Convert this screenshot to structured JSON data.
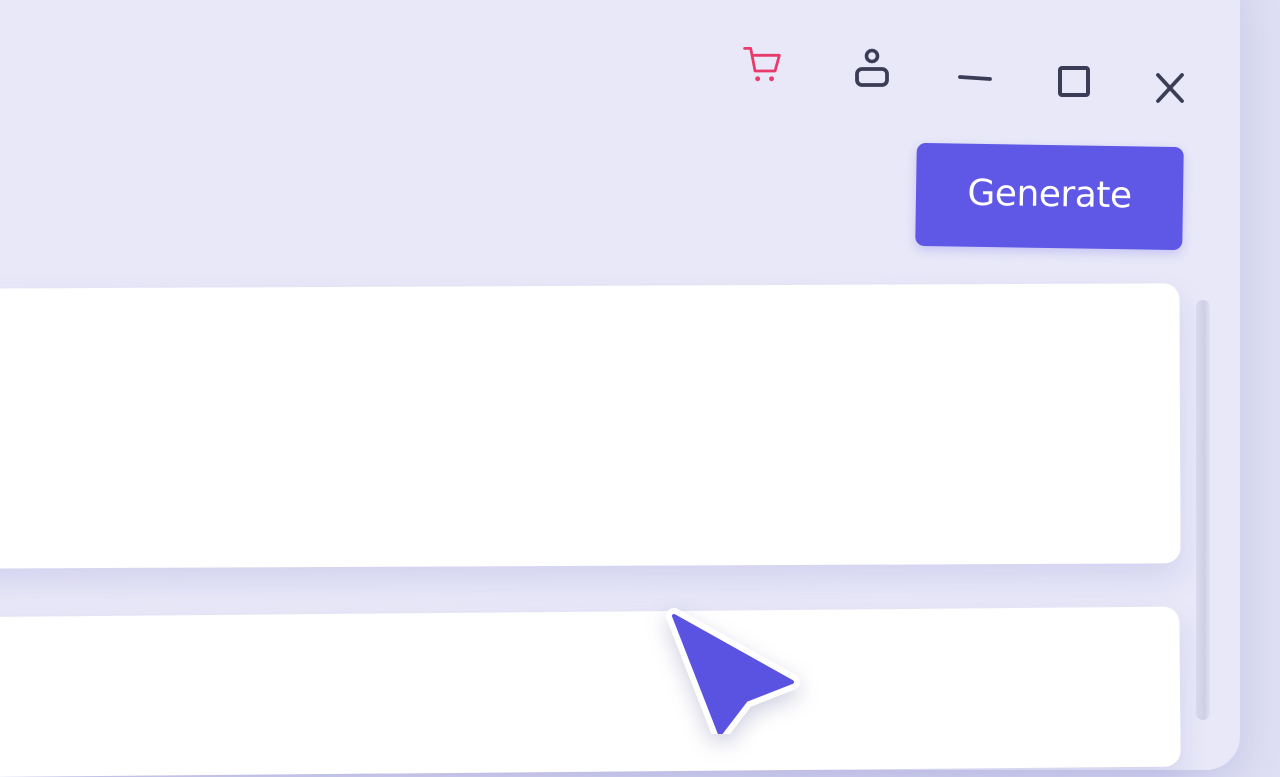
{
  "window": {
    "background_color": "#e8e8f8",
    "titlebar_icons": [
      {
        "name": "cart-icon",
        "color": "#e93a6b"
      },
      {
        "name": "user-icon",
        "color": "#3b3d57"
      },
      {
        "name": "minimize-icon",
        "color": "#3b3d57"
      },
      {
        "name": "maximize-icon",
        "color": "#3b3d57"
      },
      {
        "name": "close-icon",
        "color": "#3b3d57"
      }
    ]
  },
  "toolbar": {
    "generate_label": "Generate",
    "accent_color": "#5f57e6"
  },
  "cursor": {
    "icon": "pointer-cursor-icon",
    "color": "#5a52e0"
  }
}
